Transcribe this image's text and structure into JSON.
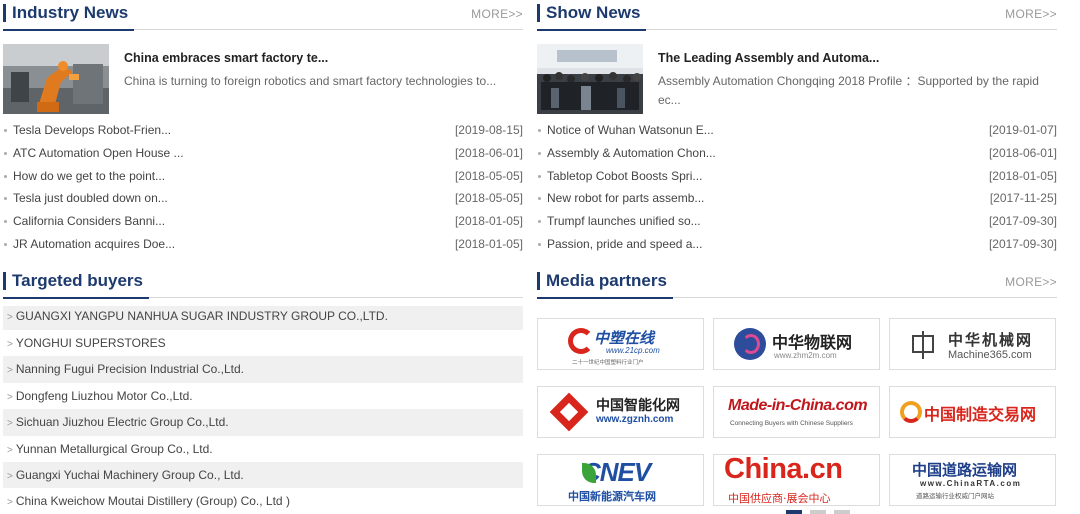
{
  "industry": {
    "title": "Industry News",
    "more": "MORE>>",
    "feature": {
      "title": "China embraces smart factory te...",
      "desc": "China is turning to foreign robotics and smart factory technologies to..."
    },
    "items": [
      {
        "text": "Tesla Develops Robot-Frien...",
        "date": "[2019-08-15]"
      },
      {
        "text": "ATC Automation Open House ...",
        "date": "[2018-06-01]"
      },
      {
        "text": "How do we get to the point...",
        "date": "[2018-05-05]"
      },
      {
        "text": "Tesla just doubled down on...",
        "date": "[2018-05-05]"
      },
      {
        "text": "California Considers Banni...",
        "date": "[2018-01-05]"
      },
      {
        "text": "JR Automation acquires Doe...",
        "date": "[2018-01-05]"
      }
    ]
  },
  "show": {
    "title": "Show News",
    "more": "MORE>>",
    "feature": {
      "title": "The Leading Assembly and Automa...",
      "desc": "Assembly Automation Chongqing 2018 Profile ：Supported by the rapid ec..."
    },
    "items": [
      {
        "text": "Notice of Wuhan Watsonun E...",
        "date": "[2019-01-07]"
      },
      {
        "text": "Assembly & Automation Chon...",
        "date": "[2018-06-01]"
      },
      {
        "text": "Tabletop Cobot Boosts Spri...",
        "date": "[2018-01-05]"
      },
      {
        "text": "New robot for parts assemb...",
        "date": "[2017-11-25]"
      },
      {
        "text": "Trumpf launches unified so...",
        "date": "[2017-09-30]"
      },
      {
        "text": "Passion, pride and speed a...",
        "date": "[2017-09-30]"
      }
    ]
  },
  "buyers": {
    "title": "Targeted buyers",
    "items": [
      "GUANGXI YANGPU NANHUA SUGAR INDUSTRY GROUP CO.,LTD.",
      "YONGHUI SUPERSTORES",
      "Nanning Fugui Precision Industrial Co.,Ltd.",
      "Dongfeng Liuzhou Motor Co.,Ltd.",
      "Sichuan Jiuzhou Electric Group Co.,Ltd.",
      "Yunnan Metallurgical Group Co., Ltd.",
      "Guangxi Yuchai Machinery Group Co., Ltd.",
      "China Kweichow Moutai Distillery (Group) Co., Ltd )"
    ]
  },
  "media": {
    "title": "Media partners",
    "more": "MORE>>",
    "logos": {
      "l1_main": "中塑在线",
      "l1_url": "www.21cp.com",
      "l1_tag": "二十一世纪中国塑料行业门户",
      "l2_main": "中华物联网",
      "l2_url": "www.zhm2m.com",
      "l3_main": "中华机械网",
      "l3_url": "Machine365.com",
      "l4_main": "中国智能化网",
      "l4_url": "www.zgznh.com",
      "l5_main": "Made-in-China.com",
      "l5_tag": "Connecting Buyers with Chinese Suppliers",
      "l6_main": "中国制造交易网",
      "l7_main": "CNEV",
      "l7_sub": "中国新能源汽车网",
      "l8_main": "China.cn",
      "l8_sub": "中国供应商·展会中心",
      "l9_main": "中国道路运输网",
      "l9_url": "www.ChinaRTA.com",
      "l9_tag": "道路运输行业权威门户网站"
    }
  },
  "colors": {
    "accent": "#1d3a6e",
    "date": "#666666",
    "alt_row": "#f0f0f0"
  }
}
